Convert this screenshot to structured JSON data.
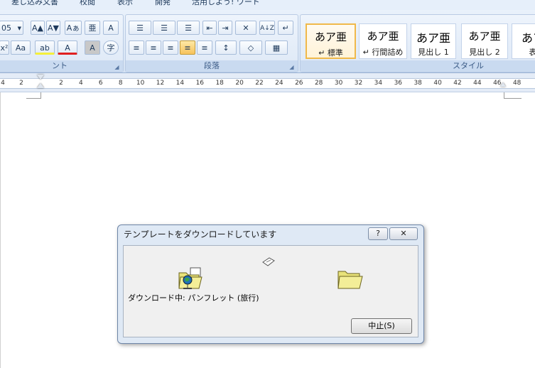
{
  "tabs": [
    "差し込み文書",
    "校閲",
    "表示",
    "開発",
    "活用しよう! ワード"
  ],
  "font_group": {
    "title": "ント",
    "font_size": "05",
    "buttons": {
      "grow": "A▲",
      "shrink": "A▼",
      "clear": "Aぁ",
      "phonetic": "亜",
      "border": "A",
      "superscript": "x²",
      "case": "Aa",
      "highlight": "ab",
      "color": "A",
      "shade": "A",
      "enclose": "字"
    }
  },
  "paragraph_group": {
    "title": "段落",
    "buttons": {
      "bullets": "☰",
      "numbering": "☰",
      "multilevel": "☰",
      "decrease_indent": "⇤",
      "increase_indent": "⇥",
      "asian": "✕",
      "sort": "A↓Z",
      "marks": "↵",
      "left": "≡",
      "center": "≡",
      "right": "≡",
      "justify": "≡",
      "distributed": "≡",
      "spacing": "↕",
      "shading": "◇",
      "borders": "▦"
    }
  },
  "style_group": {
    "title": "スタイル",
    "styles": [
      {
        "sample": "あア亜",
        "label": "↵ 標準"
      },
      {
        "sample": "あア亜",
        "label": "↵ 行間詰め"
      },
      {
        "sample": "あア亜",
        "label": "見出し 1"
      },
      {
        "sample": "あア亜",
        "label": "見出し 2"
      },
      {
        "sample": "あア",
        "label": "表"
      }
    ]
  },
  "ruler": {
    "ticks": [
      "4",
      "2",
      "2",
      "4",
      "6",
      "8",
      "10",
      "12",
      "14",
      "16",
      "18",
      "20",
      "22",
      "24",
      "26",
      "28",
      "30",
      "32",
      "34",
      "36",
      "38",
      "40",
      "42",
      "44",
      "46",
      "48"
    ]
  },
  "dialog": {
    "title": "テンプレートをダウンロードしています",
    "help": "?",
    "close": "✕",
    "status": "ダウンロード中: パンフレット (旅行)",
    "cancel": "中止(S)"
  },
  "colors": {
    "ribbon": "#d5e3f4",
    "selected_style": "#f0b94a",
    "folder": "#e8e27a"
  }
}
